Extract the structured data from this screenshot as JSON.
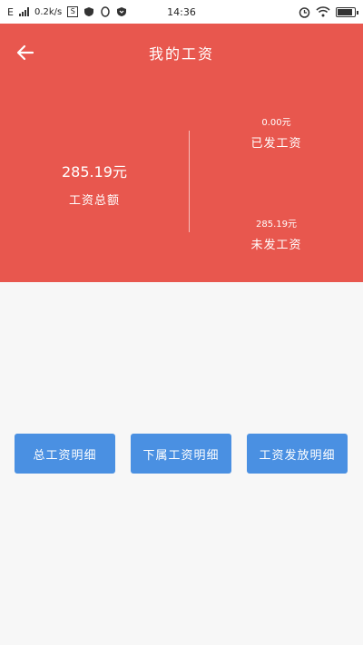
{
  "status_bar": {
    "network": "E",
    "speed": "0.2k/s",
    "time": "14:36"
  },
  "header": {
    "title": "我的工资"
  },
  "summary": {
    "total_amount": "285.19元",
    "total_label": "工资总额",
    "paid_amount": "0.00元",
    "paid_label": "已发工资",
    "unpaid_amount": "285.19元",
    "unpaid_label": "未发工资"
  },
  "buttons": {
    "total_detail": "总工资明细",
    "subordinate_detail": "下属工资明细",
    "payout_detail": "工资发放明细"
  },
  "colors": {
    "hero_bg": "#e8574e",
    "button_bg": "#4a90e2"
  }
}
